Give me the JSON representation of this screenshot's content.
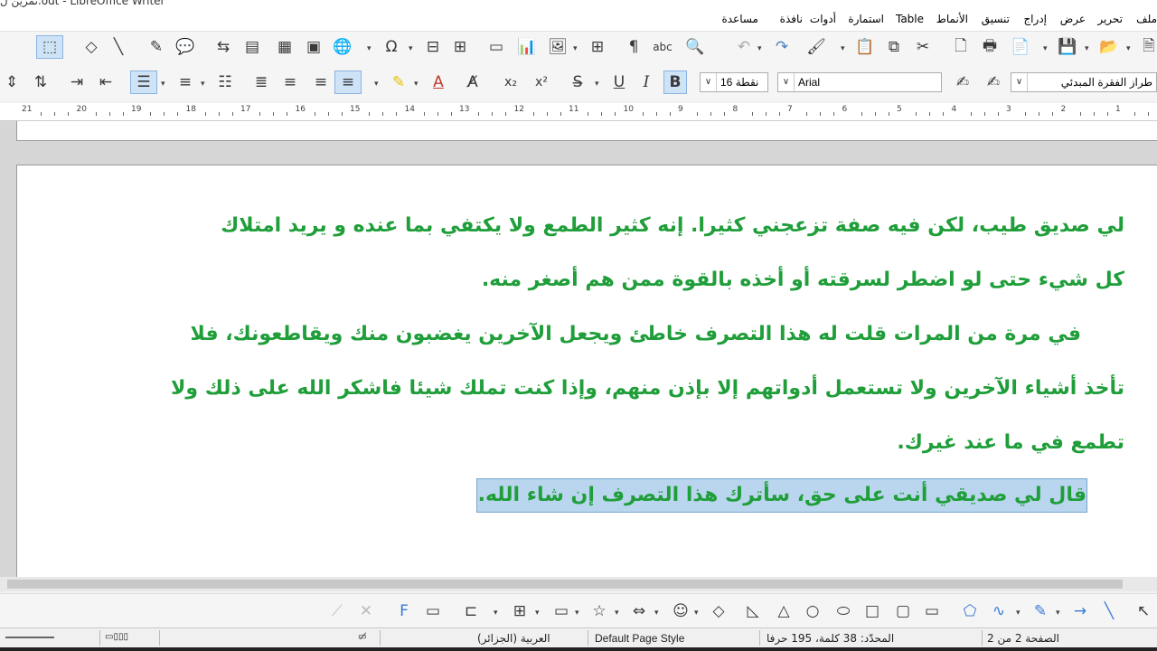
{
  "window": {
    "title": "تمرين ل.odt - LibreOffice Writer"
  },
  "menu": [
    "ملف",
    "تحرير",
    "عرض",
    "إدراج",
    "تنسيق",
    "الأنماط",
    "Table",
    "استمارة",
    "أدوات",
    "نافذة",
    "مساعدة"
  ],
  "formatting": {
    "paragraph_style": "طراز الفقرة المبدئي",
    "font_name": "Arial",
    "font_size": "نقطة 16"
  },
  "ruler": {
    "labels": [
      "21",
      "20",
      "19",
      "18",
      "17",
      "16",
      "15",
      "14",
      "13",
      "12",
      "11",
      "10",
      "9",
      "8",
      "7",
      "6",
      "5",
      "4",
      "3",
      "2",
      "1"
    ]
  },
  "document": {
    "lines": [
      "لي صديق طيب، لكن فيه صفة تزعجني كثيرا. إنه كثير الطمع ولا يكتفي بما عنده و يريد امتلاك",
      "كل شيء حتى لو اضطر لسرقته أو أخذه بالقوة ممن هم أصغر منه.",
      "في مرة من المرات قلت له هذا التصرف خاطئ ويجعل الآخرين يغضبون منك ويقاطعونك، فلا",
      "تأخذ أشياء الآخرين ولا تستعمل أدواتهم إلا بإذن منهم، وإذا كنت تملك شيئا فاشكر الله على ذلك ولا",
      "تطمع في ما عند غيرك."
    ],
    "selected_line": "قال لي صديقي أنت على حق، سأترك هذا التصرف إن شاء الله.",
    "text_color": "#1f9e3a",
    "selection_color": "#b9d6ee"
  },
  "status": {
    "page": "الصفحة 2 من 2",
    "words": "المحدّد: 38 كلمة، 195 حرفا",
    "page_style": "Default Page Style",
    "language": "العربية (الجزائر)"
  }
}
